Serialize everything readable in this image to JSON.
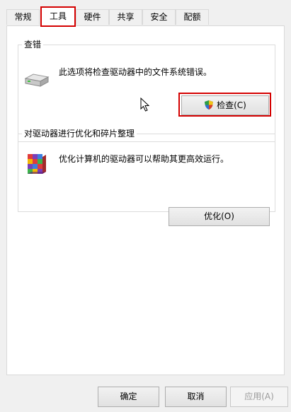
{
  "tabs": [
    {
      "label": "常规"
    },
    {
      "label": "工具"
    },
    {
      "label": "硬件"
    },
    {
      "label": "共享"
    },
    {
      "label": "安全"
    },
    {
      "label": "配额"
    }
  ],
  "active_tab": "工具",
  "error_check": {
    "title": "查错",
    "description": "此选项将检查驱动器中的文件系统错误。",
    "button_label": "检查(C)",
    "icon": "drive-icon"
  },
  "optimize": {
    "title": "对驱动器进行优化和碎片整理",
    "description": "优化计算机的驱动器可以帮助其更高效运行。",
    "button_label": "优化(O)",
    "icon": "defrag-icon"
  },
  "footer": {
    "ok_label": "确定",
    "cancel_label": "取消",
    "apply_label": "应用(A)"
  },
  "colors": {
    "highlight": "#d40000",
    "panel": "#ffffff",
    "window": "#f0f0f0"
  }
}
